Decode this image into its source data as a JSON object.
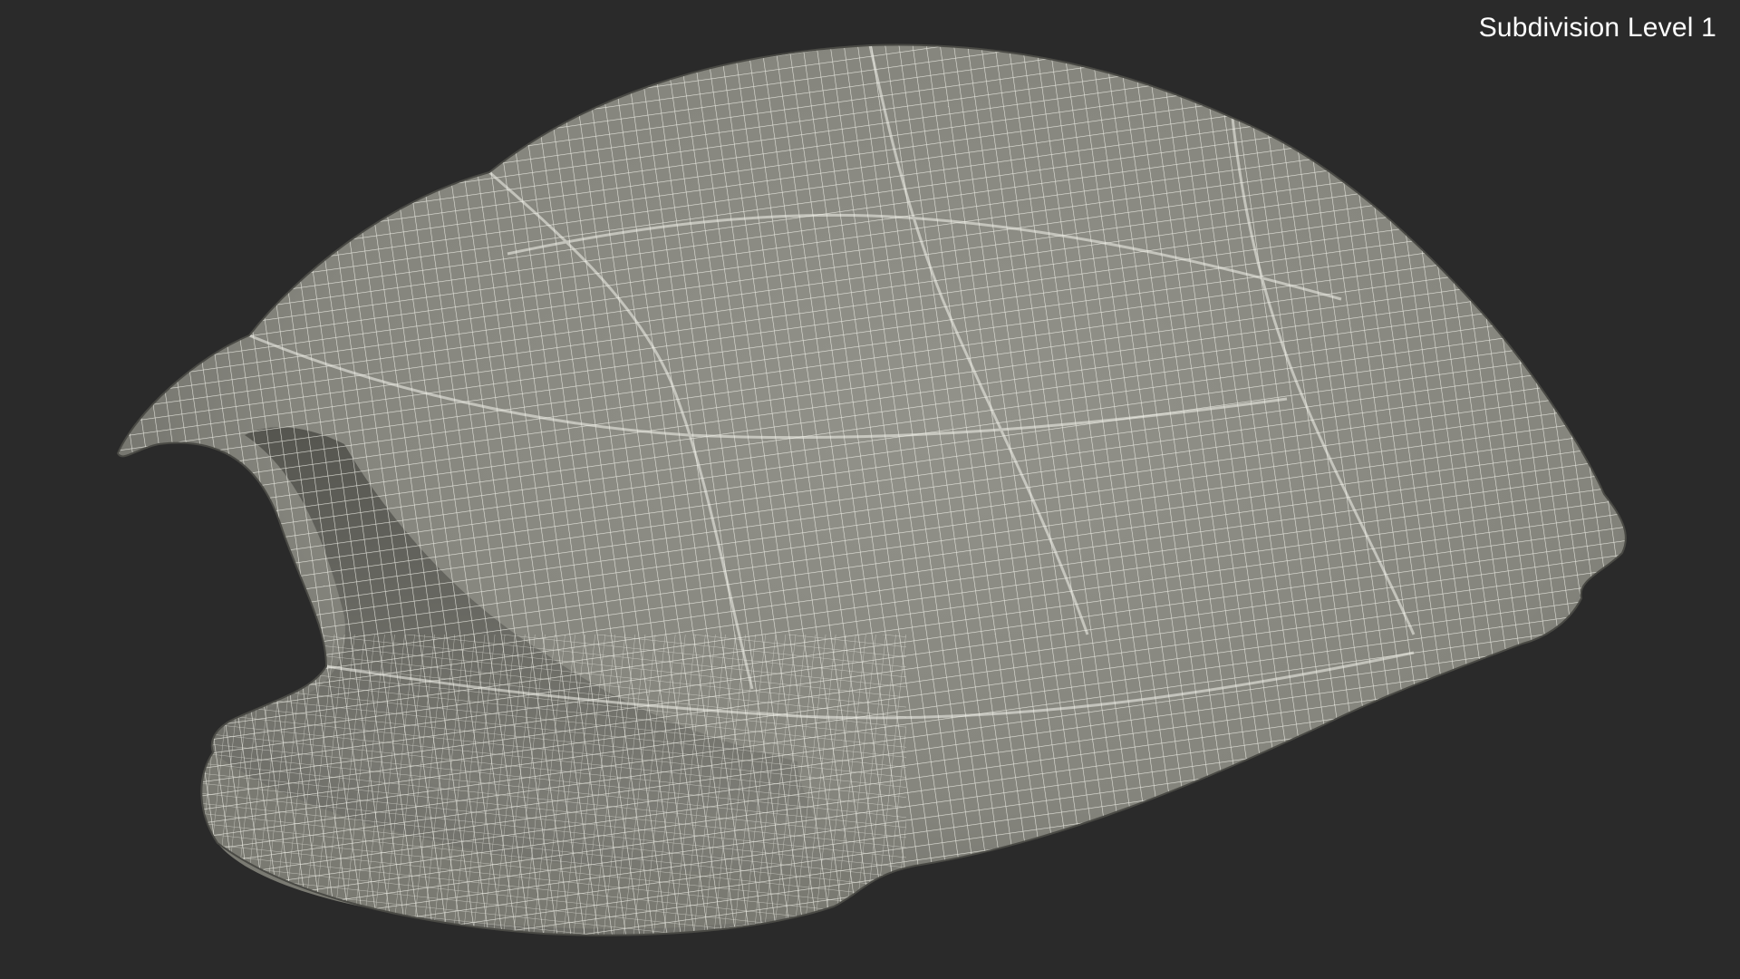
{
  "overlay": {
    "label": "Subdivision Level 1"
  },
  "scene": {
    "subject": "turtle-shell-wireframe",
    "colors": {
      "background": "#2a2a2a",
      "surface": "#8a8a80",
      "surface_shadow": "#5e5e58",
      "underside": "#70706a",
      "wireframe": "#f4f4ec"
    }
  }
}
